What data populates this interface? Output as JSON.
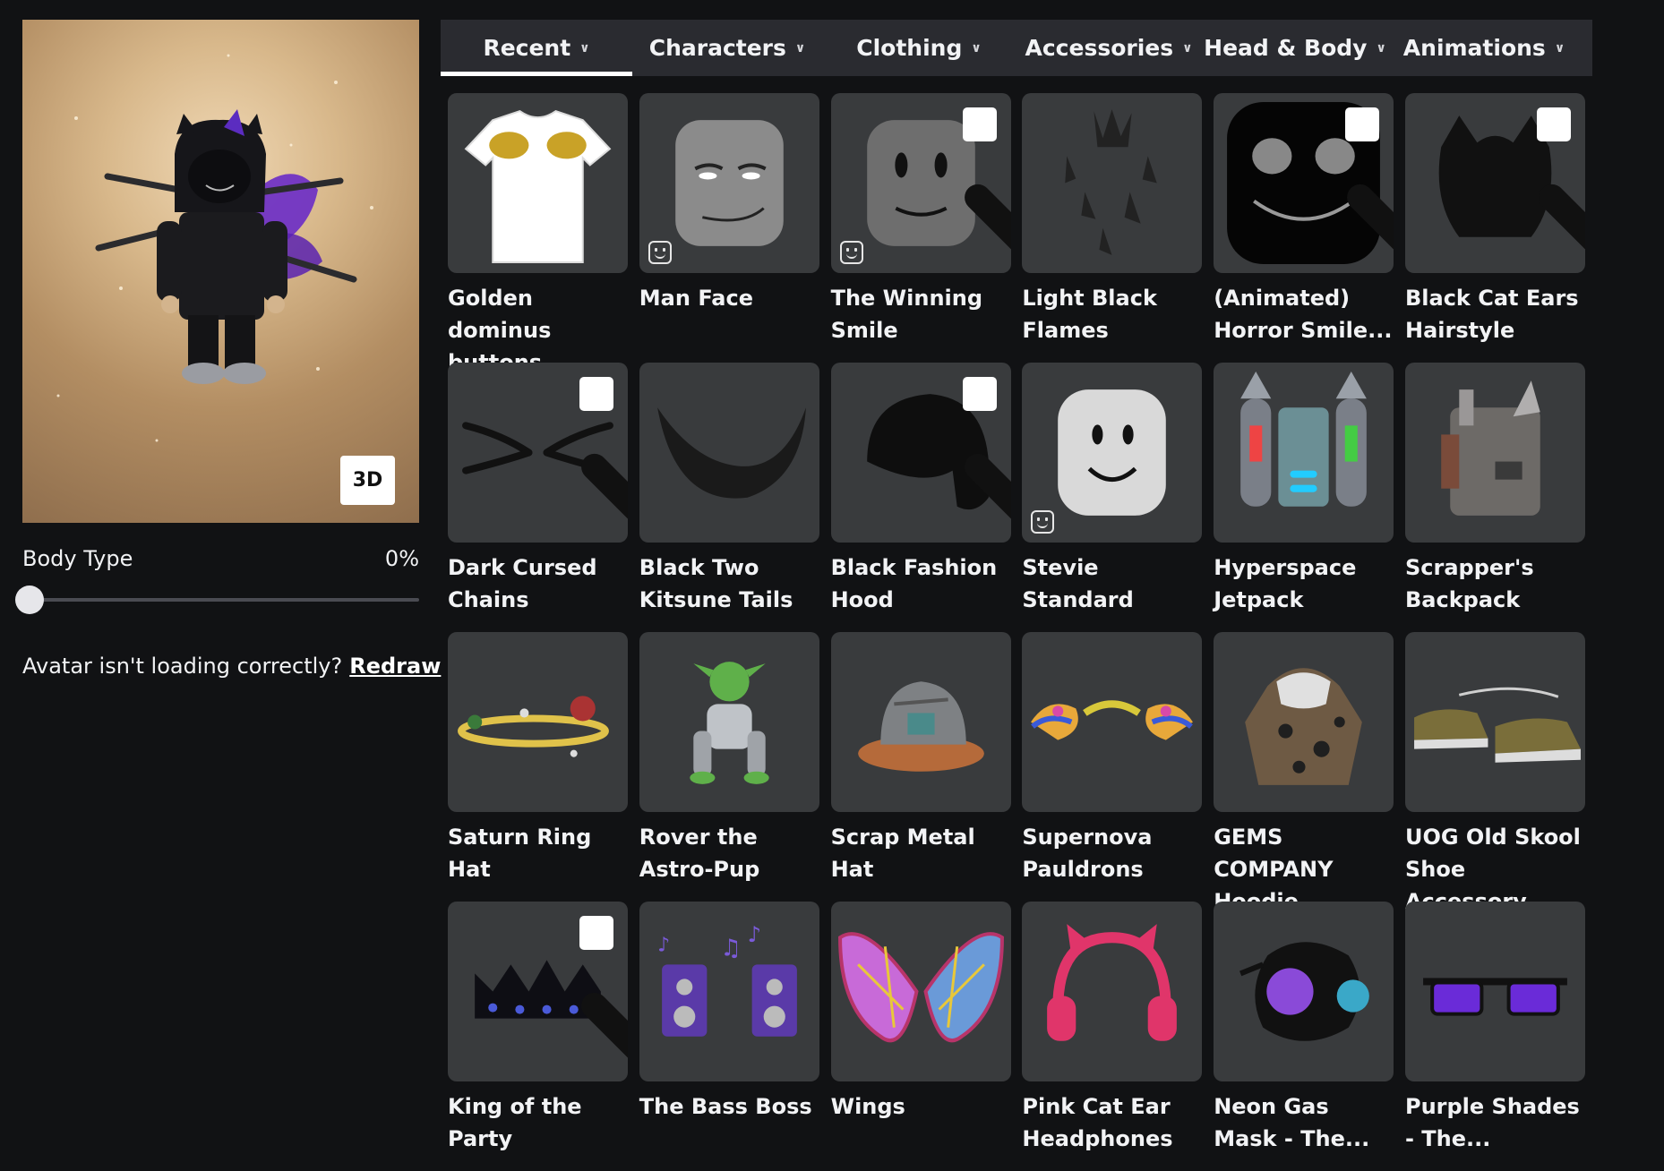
{
  "avatar_panel": {
    "view_toggle_label": "3D",
    "body_type_label": "Body Type",
    "body_type_value_text": "0%",
    "body_type_value": 0,
    "help_text": "Avatar isn't loading correctly?",
    "redraw_link": "Redraw"
  },
  "tabs": [
    {
      "label": "Recent",
      "active": true
    },
    {
      "label": "Characters",
      "active": false
    },
    {
      "label": "Clothing",
      "active": false
    },
    {
      "label": "Accessories",
      "active": false
    },
    {
      "label": "Head & Body",
      "active": false
    },
    {
      "label": "Animations",
      "active": false
    }
  ],
  "items": [
    {
      "name": "Golden dominus buttons",
      "icon": "gold-shirt",
      "equipped": false,
      "dynamic_head": false
    },
    {
      "name": "Man Face",
      "icon": "man-face-head",
      "equipped": false,
      "dynamic_head": true
    },
    {
      "name": "The Winning Smile",
      "icon": "smile-head",
      "equipped": true,
      "dynamic_head": true
    },
    {
      "name": "Light Black Flames",
      "icon": "flames",
      "equipped": false,
      "dynamic_head": false
    },
    {
      "name": "(Animated) Horror Smile...",
      "icon": "horror-mask",
      "equipped": true,
      "dynamic_head": false
    },
    {
      "name": "Black Cat Ears Hairstyle",
      "icon": "black-hair",
      "equipped": true,
      "dynamic_head": false
    },
    {
      "name": "Dark Cursed Chains",
      "icon": "chains",
      "equipped": true,
      "dynamic_head": false
    },
    {
      "name": "Black Two Kitsune Tails",
      "icon": "kitsune-tails",
      "equipped": false,
      "dynamic_head": false
    },
    {
      "name": "Black Fashion Hood",
      "icon": "black-hood",
      "equipped": true,
      "dynamic_head": false
    },
    {
      "name": "Stevie Standard",
      "icon": "stevie-head",
      "equipped": false,
      "dynamic_head": true
    },
    {
      "name": "Hyperspace Jetpack",
      "icon": "jetpack",
      "equipped": false,
      "dynamic_head": false
    },
    {
      "name": "Scrapper's Backpack",
      "icon": "backpack",
      "equipped": false,
      "dynamic_head": false
    },
    {
      "name": "Saturn Ring Hat",
      "icon": "saturn-ring",
      "equipped": false,
      "dynamic_head": false
    },
    {
      "name": "Rover the Astro-Pup",
      "icon": "astro-pup",
      "equipped": false,
      "dynamic_head": false
    },
    {
      "name": "Scrap Metal Hat",
      "icon": "scrap-hat",
      "equipped": false,
      "dynamic_head": false
    },
    {
      "name": "Supernova Pauldrons",
      "icon": "pauldrons",
      "equipped": false,
      "dynamic_head": false
    },
    {
      "name": "GEMS COMPANY Hoodie",
      "icon": "hoodie",
      "equipped": false,
      "dynamic_head": false
    },
    {
      "name": "UOG Old Skool Shoe Accessory",
      "icon": "shoes",
      "equipped": false,
      "dynamic_head": false
    },
    {
      "name": "King of the Party",
      "icon": "crown",
      "equipped": true,
      "dynamic_head": false
    },
    {
      "name": "The Bass Boss",
      "icon": "speakers",
      "equipped": false,
      "dynamic_head": false
    },
    {
      "name": "Wings",
      "icon": "butterfly-wings",
      "equipped": false,
      "dynamic_head": false
    },
    {
      "name": "Pink Cat Ear Headphones",
      "icon": "headphones",
      "equipped": false,
      "dynamic_head": false
    },
    {
      "name": "Neon Gas Mask - The...",
      "icon": "gas-mask",
      "equipped": false,
      "dynamic_head": false
    },
    {
      "name": "Purple Shades - The...",
      "icon": "purple-shades",
      "equipped": false,
      "dynamic_head": false
    }
  ]
}
